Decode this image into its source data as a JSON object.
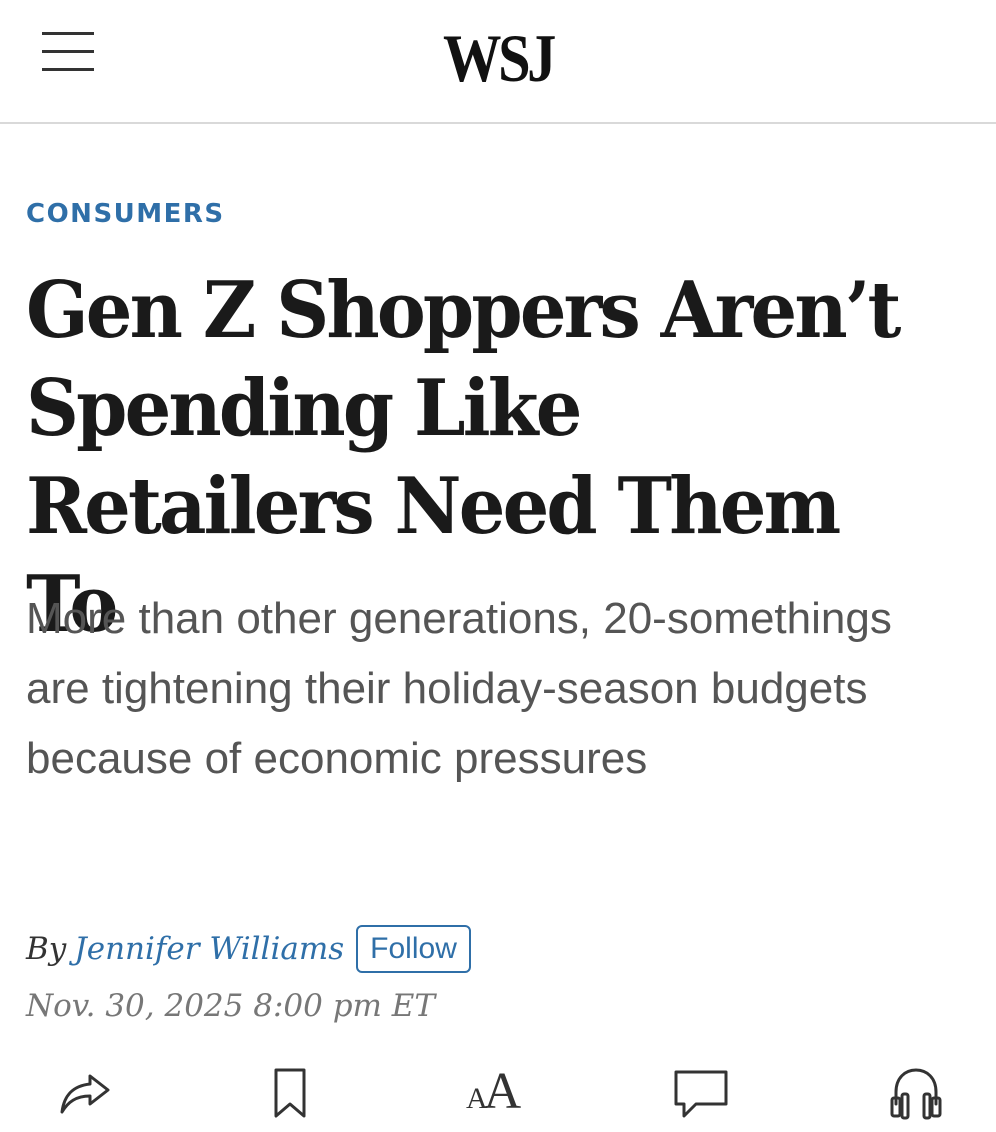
{
  "header": {
    "logo": "WSJ"
  },
  "article": {
    "category": "CONSUMERS",
    "headline": "Gen Z Shoppers Aren’t Spending Like Retailers Need Them To",
    "dek": "More than other generations, 20-somethings are tightening their holiday-season budgets because of economic pressures",
    "byline_prefix": "By",
    "author": "Jennifer Williams",
    "follow_label": "Follow",
    "timestamp": "Nov. 30, 2025 8:00 pm ET"
  },
  "toolbar": {
    "icons": [
      "share-icon",
      "bookmark-icon",
      "text-size-icon",
      "comment-icon",
      "headphones-icon"
    ],
    "text_size_small": "A",
    "text_size_large": "A"
  },
  "colors": {
    "accent": "#2f6fa8",
    "headline": "#1a1a1a",
    "dek": "#555555",
    "timestamp": "#777777"
  }
}
